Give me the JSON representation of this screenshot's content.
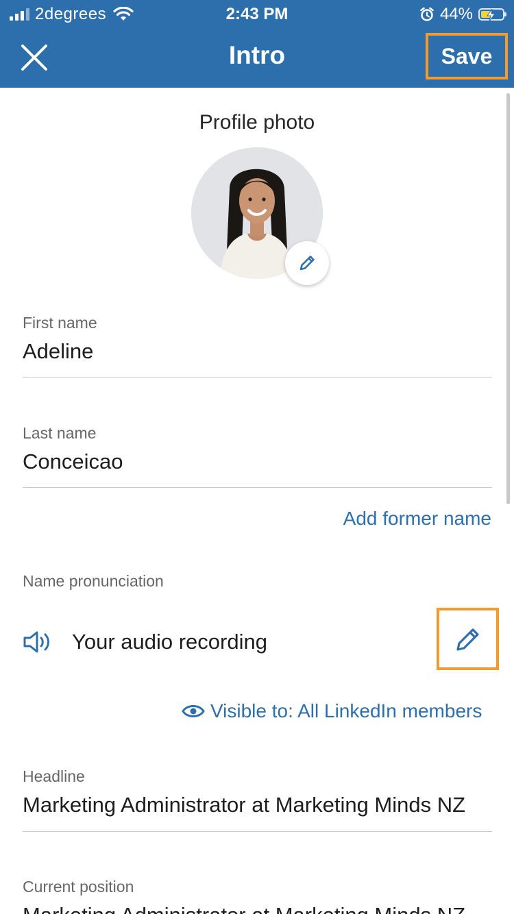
{
  "status_bar": {
    "carrier": "2degrees",
    "time": "2:43 PM",
    "battery_percent": "44%",
    "icons": [
      "signal-icon",
      "wifi-icon",
      "alarm-icon",
      "battery-charging-icon"
    ]
  },
  "header": {
    "title": "Intro",
    "save_label": "Save",
    "close_icon": "close-icon",
    "background_color": "#2d6fad",
    "highlight_color": "#f39b2d"
  },
  "profile_photo": {
    "title": "Profile photo",
    "edit_icon": "pencil-icon"
  },
  "fields": {
    "first_name": {
      "label": "First name",
      "value": "Adeline"
    },
    "last_name": {
      "label": "Last name",
      "value": "Conceicao"
    },
    "add_former_name": "Add former name",
    "pronunciation": {
      "label": "Name pronunciation",
      "audio_text": "Your audio recording",
      "speaker_icon": "speaker-icon",
      "edit_icon": "pencil-icon"
    },
    "visibility": {
      "text": "Visible to: All LinkedIn members",
      "icon": "eye-icon"
    },
    "headline": {
      "label": "Headline",
      "value": "Marketing Administrator at Marketing Minds NZ"
    },
    "current_position": {
      "label": "Current position",
      "value": "Marketing Administrator at Marketing Minds NZ"
    }
  },
  "colors": {
    "link": "#2d6fad",
    "label": "#666666",
    "text": "#1d1d1f"
  }
}
